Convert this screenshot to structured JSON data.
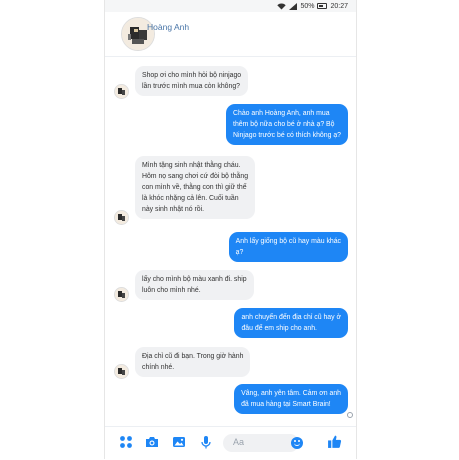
{
  "status_bar": {
    "battery": "50%",
    "time": "20:27"
  },
  "header": {
    "name": "Hoàng Anh"
  },
  "messages": [
    {
      "dir": "in",
      "text": "Shop ơi cho mình hỏi bộ ninjago\nlần trước mình mua còn không?"
    },
    {
      "dir": "out",
      "text": "Chào anh Hoàng Anh, anh mua\nthêm bộ nữa cho bé ở nhà ạ? Bộ\nNinjago trước bé có thích không ạ?"
    },
    {
      "dir": "in",
      "text": "Mình tặng sinh nhật thằng cháu.\nHôm nọ sang chơi cứ đòi bộ thằng\ncon mình về, thằng con thì giữ thế\nlà khóc nhặng cả lên. Cuối tuần\nnày sinh nhật nó rồi."
    },
    {
      "dir": "out",
      "text": "Anh lấy giống bộ cũ hay màu khác\nạ?"
    },
    {
      "dir": "in",
      "text": "lấy cho mình bộ màu xanh đi. ship\nluôn cho mình nhé."
    },
    {
      "dir": "out",
      "text": "anh chuyển đến địa chỉ cũ hay ở\nđâu để em ship cho anh."
    },
    {
      "dir": "in",
      "text": "Địa chỉ cũ đi bạn. Trong giờ hành\nchính nhé."
    },
    {
      "dir": "out",
      "text": "Vâng, anh yên tâm. Cảm ơn anh\nđã mua hàng tại Smart Brain!"
    }
  ],
  "composer": {
    "placeholder": "Aa"
  },
  "colors": {
    "accent": "#1e86f5",
    "incoming_bubble": "#f0f1f3"
  },
  "icons": [
    "apps-icon",
    "camera-icon",
    "image-icon",
    "microphone-icon",
    "emoji-icon",
    "thumbs-up-icon"
  ]
}
